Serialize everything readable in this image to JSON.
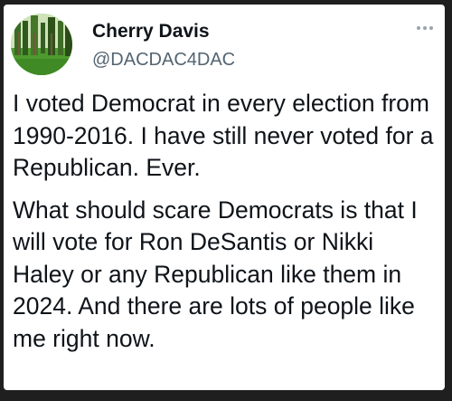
{
  "author": {
    "display_name": "Cherry Davis",
    "handle": "@DACDAC4DAC",
    "avatar_icon": "forest-trees-avatar"
  },
  "menu": {
    "more_icon": "more-options-icon"
  },
  "tweet": {
    "paragraphs": [
      "I voted Democrat in every election from 1990-2016. I have still never voted for a Republican. Ever.",
      "What should scare Democrats is that I will vote for Ron DeSantis or Nikki Haley or any Republican like them in 2024. And there are lots of people like me right now."
    ]
  },
  "colors": {
    "background": "#1f1f1f",
    "card": "#ffffff",
    "text": "#0f1419",
    "secondary_text": "#536471"
  }
}
